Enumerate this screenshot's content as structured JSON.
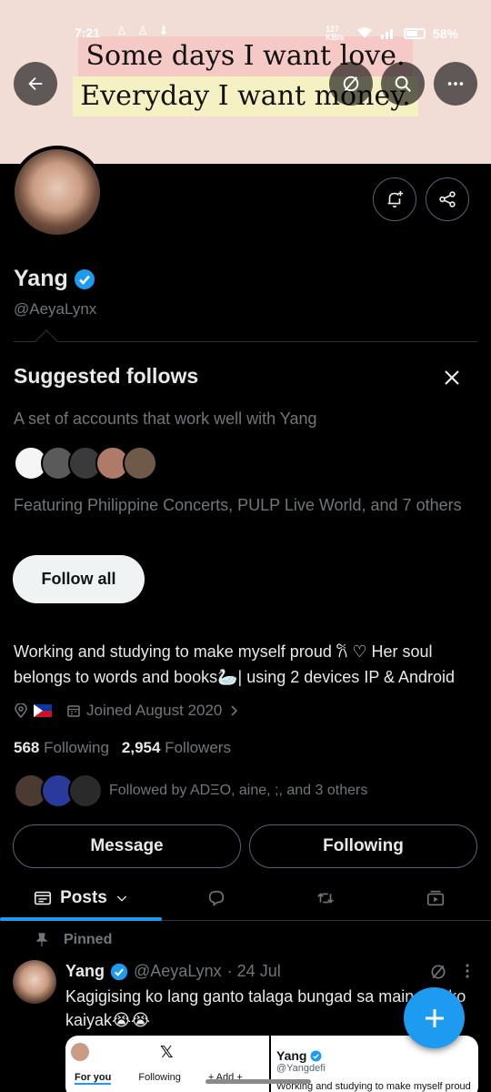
{
  "status": {
    "time": "7:21",
    "left_icons": "♙ ♙ ⬇",
    "right_text": "58%",
    "net_speed": "127 KB/s"
  },
  "banner": {
    "line1": "Some days I want love.",
    "line2": "Everyday I want money."
  },
  "profile": {
    "name": "Yang",
    "handle": "@AeyaLynx",
    "bio": "Working and studying to make myself proud 𐙚 ♡ Her soul belongs to words and books🦢| using 2 devices IP & Android",
    "joined": "Joined August 2020",
    "following_count": "568",
    "following_label": "Following",
    "followers_count": "2,954",
    "followers_label": "Followers",
    "followed_by": "Followed by ADΞO, aine, ;, and 3 others"
  },
  "suggested": {
    "title": "Suggested follows",
    "subtitle": "A set of accounts that work well with Yang",
    "featuring": "Featuring Philippine Concerts, PULP Live World, and 7 others",
    "follow_all": "Follow all"
  },
  "actions": {
    "message": "Message",
    "following": "Following"
  },
  "tabs": {
    "posts": "Posts"
  },
  "pinned_tweet": {
    "pinned_label": "Pinned",
    "name": "Yang",
    "handle": "@AeyaLynx",
    "date": "· 24 Jul",
    "text": "Kagigising ko lang ganto talaga bungad sa main acc ko kaiyak😭😭",
    "media_left": {
      "x_logo": "𝕏",
      "tab_for_you": "For you",
      "tab_following": "Following",
      "tab_add": "+ Add +"
    },
    "media_right": {
      "name": "Yang",
      "handle": "@Yangdefi",
      "bio": "Working and studying to make myself proud"
    }
  },
  "colors": {
    "accent": "#1d9bf0",
    "background": "#000000",
    "text": "#e7e9ea",
    "muted": "#71767b",
    "banner": "#f1ddd6"
  }
}
